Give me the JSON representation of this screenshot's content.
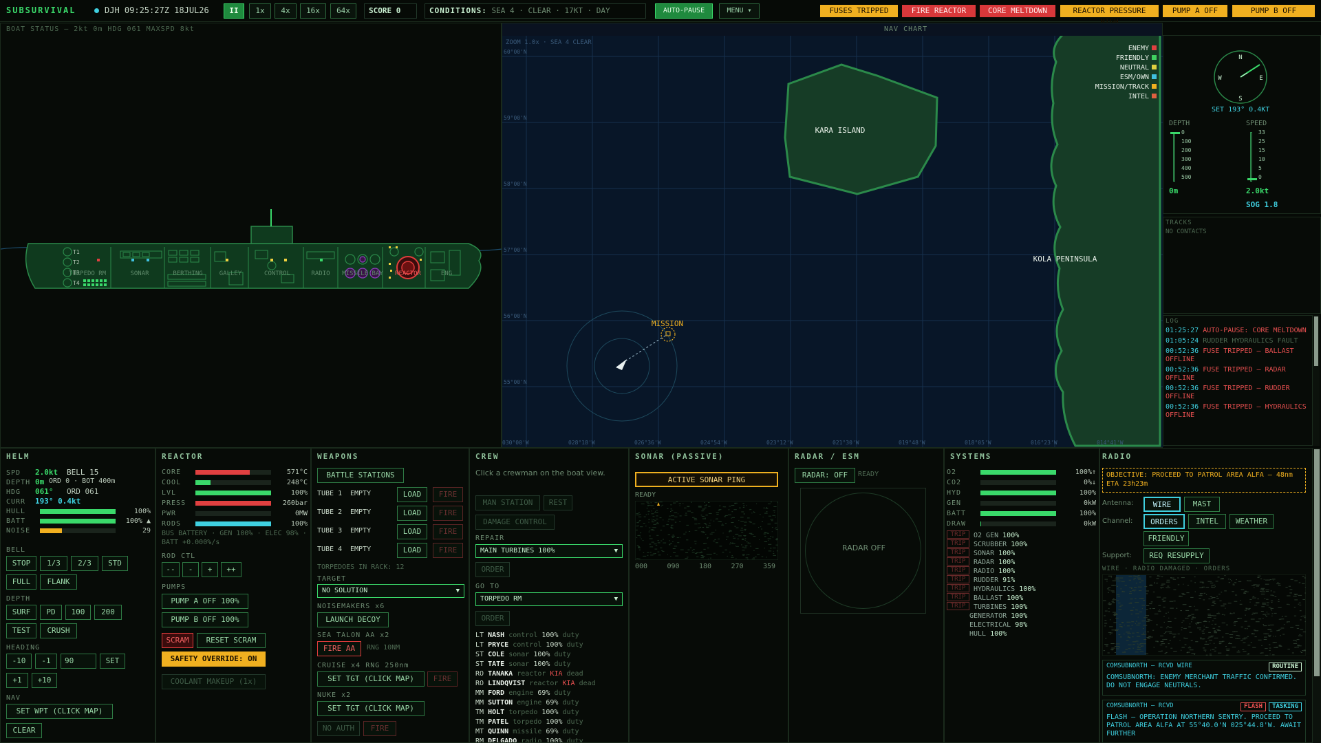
{
  "top": {
    "brand": "SUBSURVIVAL",
    "clock": "DJH 09:25:27Z 18JUL26",
    "pause_label": "II",
    "speeds": [
      "1x",
      "4x",
      "16x",
      "64x"
    ],
    "score_label": "SCORE",
    "score_value": "0",
    "conditions_label": "CONDITIONS:",
    "conditions_value": "SEA 4 · CLEAR · 17KT · DAY",
    "autopause": "AUTO-PAUSE",
    "menu": "MENU ▾",
    "alerts": [
      {
        "text": "FUSES TRIPPED",
        "kind": "amber"
      },
      {
        "text": "FIRE REACTOR",
        "kind": "red"
      },
      {
        "text": "CORE MELTDOWN",
        "kind": "red"
      },
      {
        "text": "REACTOR PRESSURE HIGH",
        "kind": "amber"
      },
      {
        "text": "PUMP A OFF",
        "kind": "amber"
      },
      {
        "text": "PUMP B OFF",
        "kind": "amber"
      }
    ]
  },
  "boat": {
    "status": "BOAT STATUS — 2kt 0m HDG 061 MAXSPD 8kt",
    "tubes": [
      "T1",
      "T2",
      "T3",
      "T4"
    ],
    "compartments": [
      "TORPEDO RM",
      "SONAR",
      "BERTHING",
      "GALLEY",
      "CONTROL",
      "RADIO",
      "MISSILE BAY",
      "REACTOR",
      "ENG"
    ]
  },
  "nav": {
    "title": "NAV CHART",
    "zoom": "ZOOM 1.0x · SEA 4 CLEAR",
    "lat_labels": [
      "60°00'N",
      "59°00'N",
      "58°00'N",
      "57°00'N",
      "56°00'N",
      "55°00'N"
    ],
    "lon_labels": [
      "030°00'W",
      "028°18'W",
      "026°36'W",
      "024°54'W",
      "023°12'W",
      "021°30'W",
      "019°48'W",
      "018°05'W",
      "016°23'W",
      "014°41'W"
    ],
    "kara": "KARA ISLAND",
    "kola": "KOLA PENINSULA",
    "mission": "MISSION",
    "legend": [
      {
        "label": "ENEMY",
        "color": "#e04040"
      },
      {
        "label": "FRIENDLY",
        "color": "#40d060"
      },
      {
        "label": "NEUTRAL",
        "color": "#e0d040"
      },
      {
        "label": "ESM/OWN",
        "color": "#40c0e0"
      },
      {
        "label": "MISSION/TRACK",
        "color": "#f0b020"
      },
      {
        "label": "INTEL",
        "color": "#e06040"
      }
    ]
  },
  "nav_side": {
    "compass": {
      "n": "N",
      "e": "E",
      "s": "S",
      "w": "W"
    },
    "set": "SET 193° 0.4KT",
    "depth_label": "DEPTH",
    "speed_label": "SPEED",
    "depth_ticks": [
      "0",
      "100",
      "200",
      "300",
      "400",
      "500"
    ],
    "speed_ticks": [
      "33",
      "25",
      "15",
      "10",
      "5",
      "0"
    ],
    "depth_value": "0m",
    "speed_value": "2.0kt",
    "sog": "SOG 1.8",
    "tracks_title": "TRACKS",
    "tracks_empty": "NO CONTACTS",
    "log_title": "LOG",
    "log": [
      {
        "time": "01:25:27",
        "text": "AUTO-PAUSE: CORE MELTDOWN",
        "kind": "red"
      },
      {
        "time": "01:05:24",
        "text": "RUDDER HYDRAULICS FAULT",
        "kind": "dim"
      },
      {
        "time": "00:52:36",
        "text": "FUSE TRIPPED — BALLAST OFFLINE",
        "kind": "red"
      },
      {
        "time": "00:52:36",
        "text": "FUSE TRIPPED — RADAR OFFLINE",
        "kind": "red"
      },
      {
        "time": "00:52:36",
        "text": "FUSE TRIPPED — RUDDER OFFLINE",
        "kind": "red"
      },
      {
        "time": "00:52:36",
        "text": "FUSE TRIPPED — HYDRAULICS OFFLINE",
        "kind": "red"
      }
    ]
  },
  "helm": {
    "title": "HELM",
    "spd_l": "SPD",
    "spd_v": "2.0kt",
    "bell": "BELL 15",
    "depth_l": "DEPTH",
    "depth_v": "0m",
    "ord_d": "ORD 0 · BOT 400m",
    "hdg_l": "HDG",
    "hdg_v": "061°",
    "ord_h": "ORD 061",
    "curr_l": "CURR",
    "curr_v": "193° 0.4kt",
    "hull_l": "HULL",
    "hull_v": "100%",
    "hull_pct": 100,
    "batt_l": "BATT",
    "batt_v": "100% ▲",
    "batt_pct": 100,
    "noise_l": "NOISE",
    "noise_v": "29",
    "noise_pct": 29,
    "bell_l": "BELL",
    "bell_btns": [
      "STOP",
      "1/3",
      "2/3",
      "STD",
      "FULL",
      "FLANK"
    ],
    "depth_sec": "DEPTH",
    "depth_btns": [
      "SURF",
      "PD",
      "100",
      "200",
      "TEST",
      "CRUSH"
    ],
    "heading_sec": "HEADING",
    "heading_btns": [
      "-10",
      "-1",
      "90",
      "SET",
      "+1",
      "+10"
    ],
    "nav_sec": "NAV",
    "setwpt": "SET WPT (CLICK MAP)",
    "clear": "CLEAR"
  },
  "reactor": {
    "title": "REACTOR",
    "rows": [
      {
        "l": "CORE",
        "v": "571°C",
        "pct": 72,
        "c": "#e04040"
      },
      {
        "l": "COOL",
        "v": "248°C",
        "pct": 20,
        "c": "#3ad96a"
      },
      {
        "l": "LVL",
        "v": "100%",
        "pct": 100,
        "c": "#3ad96a"
      },
      {
        "l": "PRESS",
        "v": "260bar",
        "pct": 100,
        "c": "#e04040"
      },
      {
        "l": "PWR",
        "v": "0MW",
        "pct": 0,
        "c": "#3ad96a"
      },
      {
        "l": "RODS",
        "v": "100%",
        "pct": 100,
        "c": "#3fd0e0"
      }
    ],
    "bus": "BUS BATTERY · GEN 100% · ELEC 98% · BATT +0.000%/s",
    "rod_ctl": "ROD CTL",
    "rod_btns": [
      "--",
      "-",
      "+",
      "++"
    ],
    "pumps": "PUMPS",
    "pump_a": "PUMP A OFF 100%",
    "pump_b": "PUMP B OFF 100%",
    "scram": "SCRAM",
    "reset_scram": "RESET SCRAM",
    "override": "SAFETY OVERRIDE: ON",
    "makeup": "COOLANT MAKEUP (1x)"
  },
  "weapons": {
    "title": "WEAPONS",
    "battle": "BATTLE STATIONS",
    "tubes": [
      {
        "name": "TUBE 1",
        "state": "EMPTY"
      },
      {
        "name": "TUBE 2",
        "state": "EMPTY"
      },
      {
        "name": "TUBE 3",
        "state": "EMPTY"
      },
      {
        "name": "TUBE 4",
        "state": "EMPTY"
      }
    ],
    "load": "LOAD",
    "fire": "FIRE",
    "rack": "TORPEDOES IN RACK: 12",
    "target_l": "TARGET",
    "target_v": "NO SOLUTION",
    "noise_l": "NOISEMAKERS x6",
    "decoy": "LAUNCH DECOY",
    "sam_l": "SEA TALON AA x2",
    "fire_aa": "FIRE AA",
    "rng_aa": "RNG 10NM",
    "cruise_l": "CRUISE x4 RNG 250nm",
    "set_tgt": "SET TGT (CLICK MAP)",
    "nuke_l": "NUKE x2",
    "no_auth": "NO AUTH"
  },
  "crew": {
    "title": "CREW",
    "hint": "Click a crewman on the boat view.",
    "man": "MAN STATION",
    "rest": "REST",
    "dmg": "DAMAGE CONTROL",
    "repair_l": "REPAIR",
    "repair_v": "MAIN TURBINES 100%",
    "order": "ORDER",
    "goto_l": "GO TO",
    "goto_v": "TORPEDO RM",
    "members": [
      {
        "rank": "LT",
        "name": "NASH",
        "job": "control",
        "pct": "100%",
        "st": "duty",
        "kia": false
      },
      {
        "rank": "LT",
        "name": "PRYCE",
        "job": "control",
        "pct": "100%",
        "st": "duty",
        "kia": false
      },
      {
        "rank": "ST",
        "name": "COLE",
        "job": "sonar",
        "pct": "100%",
        "st": "duty",
        "kia": false
      },
      {
        "rank": "ST",
        "name": "TATE",
        "job": "sonar",
        "pct": "100%",
        "st": "duty",
        "kia": false
      },
      {
        "rank": "RO",
        "name": "TANAKA",
        "job": "reactor",
        "pct": "KIA",
        "st": "dead",
        "kia": true
      },
      {
        "rank": "RO",
        "name": "LINDQVIST",
        "job": "reactor",
        "pct": "KIA",
        "st": "dead",
        "kia": true
      },
      {
        "rank": "MM",
        "name": "FORD",
        "job": "engine",
        "pct": "69%",
        "st": "duty",
        "kia": false
      },
      {
        "rank": "MM",
        "name": "SUTTON",
        "job": "engine",
        "pct": "69%",
        "st": "duty",
        "kia": false
      },
      {
        "rank": "TM",
        "name": "HOLT",
        "job": "torpedo",
        "pct": "100%",
        "st": "duty",
        "kia": false
      },
      {
        "rank": "TM",
        "name": "PATEL",
        "job": "torpedo",
        "pct": "100%",
        "st": "duty",
        "kia": false
      },
      {
        "rank": "MT",
        "name": "QUINN",
        "job": "missile",
        "pct": "69%",
        "st": "duty",
        "kia": false
      },
      {
        "rank": "RM",
        "name": "DELGADO",
        "job": "radio",
        "pct": "100%",
        "st": "duty",
        "kia": false
      }
    ]
  },
  "sonar": {
    "title": "SONAR (PASSIVE)",
    "ping": "ACTIVE SONAR PING",
    "ready": "READY",
    "bearings": [
      "000",
      "090",
      "180",
      "270",
      "359"
    ]
  },
  "radar": {
    "title": "RADAR / ESM",
    "toggle": "RADAR: OFF",
    "ready": "READY",
    "off": "RADAR OFF"
  },
  "systems": {
    "title": "SYSTEMS",
    "bars": [
      {
        "l": "O2",
        "v": "100%↑",
        "pct": 100
      },
      {
        "l": "CO2",
        "v": "0%↓",
        "pct": 0
      },
      {
        "l": "HYD",
        "v": "100%",
        "pct": 100
      },
      {
        "l": "GEN",
        "v": "0kW",
        "pct": 0
      },
      {
        "l": "BATT",
        "v": "100%",
        "pct": 100
      },
      {
        "l": "DRAW",
        "v": "0kW",
        "pct": 1
      }
    ],
    "trip": "TRIP",
    "items": [
      {
        "n": "O2 GEN",
        "v": "100%",
        "trip": true
      },
      {
        "n": "SCRUBBER",
        "v": "100%",
        "trip": true
      },
      {
        "n": "SONAR",
        "v": "100%",
        "trip": true
      },
      {
        "n": "RADAR",
        "v": "100%",
        "trip": true
      },
      {
        "n": "RADIO",
        "v": "100%",
        "trip": true
      },
      {
        "n": "RUDDER",
        "v": "91%",
        "trip": true
      },
      {
        "n": "HYDRAULICS",
        "v": "100%",
        "trip": true
      },
      {
        "n": "BALLAST",
        "v": "100%",
        "trip": true
      },
      {
        "n": "TURBINES",
        "v": "100%",
        "trip": true
      },
      {
        "n": "GENERATOR",
        "v": "100%",
        "trip": false
      },
      {
        "n": "ELECTRICAL",
        "v": "98%",
        "trip": false
      },
      {
        "n": "HULL",
        "v": "100%",
        "trip": false
      }
    ]
  },
  "radio": {
    "title": "RADIO",
    "objective": "OBJECTIVE: PROCEED TO PATROL AREA ALFA — 48nm ETA 23h23m",
    "antenna_l": "Antenna:",
    "wire": "WIRE",
    "mast": "MAST",
    "channel_l": "Channel:",
    "orders": "ORDERS",
    "intel": "INTEL",
    "weather": "WEATHER",
    "friendly": "FRIENDLY",
    "support_l": "Support:",
    "resupply": "REQ RESUPPLY",
    "status": "WIRE · RADIO DAMAGED · ORDERS",
    "msgs": [
      {
        "from": "COMSUBNORTH — RCVD WIRE",
        "tags": [
          "ROUTINE"
        ],
        "body": "COMSUBNORTH: ENEMY MERCHANT TRAFFIC CONFIRMED. DO NOT ENGAGE NEUTRALS."
      },
      {
        "from": "COMSUBNORTH — RCVD",
        "tags": [
          "FLASH",
          "TASKING"
        ],
        "body": "FLASH — OPERATION NORTHERN SENTRY. PROCEED TO PATROL AREA ALFA AT 55°40.0'N 025°44.8'W. AWAIT FURTHER"
      }
    ]
  },
  "colors": {
    "accent": "#3ad96a",
    "alarm": "#e03c3c",
    "warn": "#f0b020",
    "info": "#3fd0e0"
  }
}
